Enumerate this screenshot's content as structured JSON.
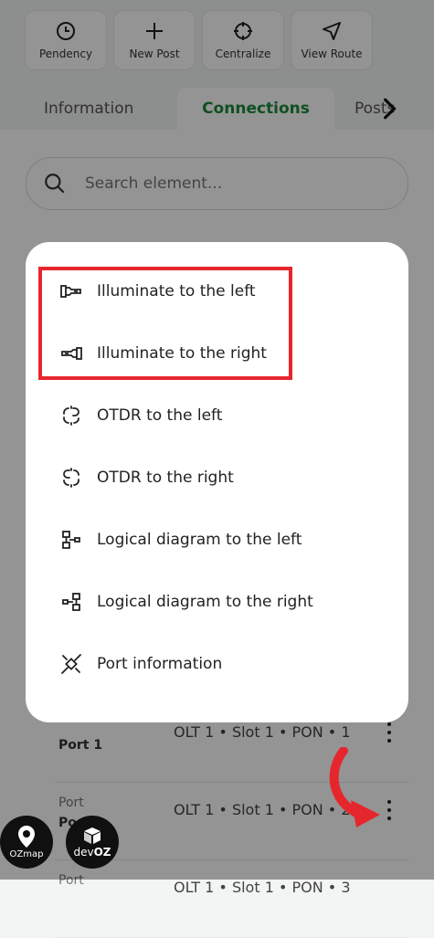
{
  "actions": [
    {
      "label": "Pendency",
      "icon": "clock-icon"
    },
    {
      "label": "New Post",
      "icon": "plus-icon"
    },
    {
      "label": "Centralize",
      "icon": "crosshair-icon"
    },
    {
      "label": "View Route",
      "icon": "navigation-icon"
    }
  ],
  "tabs": [
    {
      "label": "Information"
    },
    {
      "label": "Connections"
    },
    {
      "label": "Posts"
    }
  ],
  "search": {
    "placeholder": "Search element..."
  },
  "rows": [
    {
      "port_small": "",
      "port_big": "Port 1",
      "path": "OLT 1 • Slot 1 • PON • 1"
    },
    {
      "port_small": "Port",
      "port_big": "Po",
      "path": "OLT 1 • Slot 1 • PON • 2"
    },
    {
      "port_small": "Port",
      "port_big": "",
      "path": "OLT 1 • Slot 1 • PON • 3"
    }
  ],
  "menu": [
    {
      "label": "Illuminate to the left",
      "icon": "flashlight-left-icon"
    },
    {
      "label": "Illuminate to the right",
      "icon": "flashlight-right-icon"
    },
    {
      "label": "OTDR to the left",
      "icon": "otdr-left-icon"
    },
    {
      "label": "OTDR to the right",
      "icon": "otdr-right-icon"
    },
    {
      "label": "Logical diagram to the left",
      "icon": "diagram-left-icon"
    },
    {
      "label": "Logical diagram to the right",
      "icon": "diagram-right-icon"
    },
    {
      "label": "Port information",
      "icon": "port-info-icon"
    }
  ],
  "brand": {
    "badge1": "OZmap",
    "badge2_a": "dev",
    "badge2_b": "OZ"
  },
  "colors": {
    "accent": "#1d8a3c",
    "highlight": "#e6262d"
  }
}
